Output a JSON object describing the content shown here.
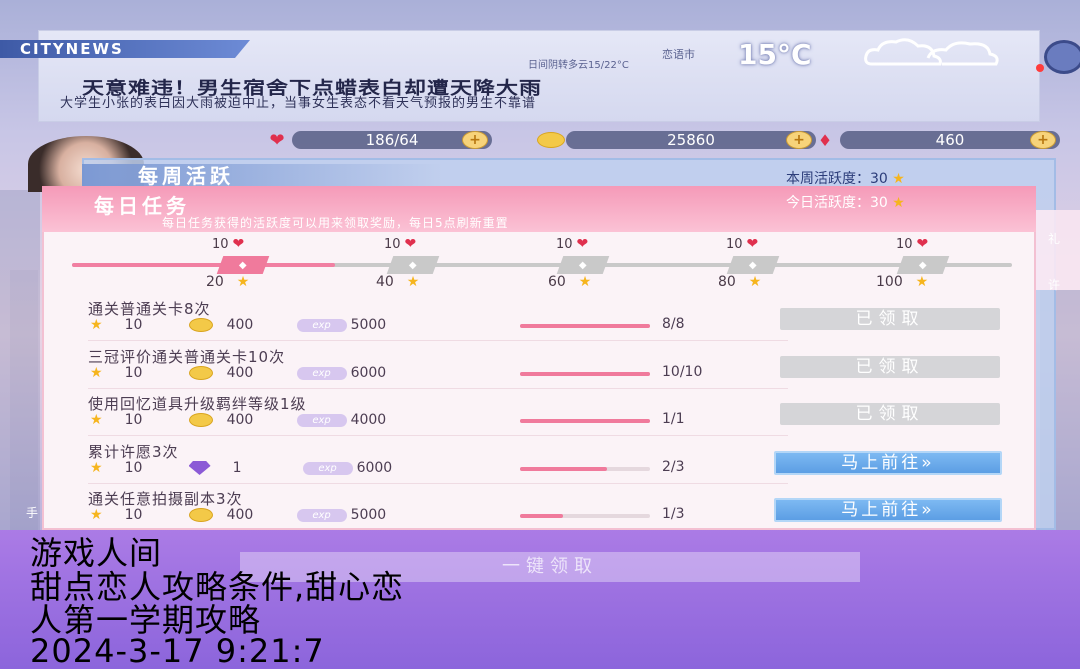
{
  "news": {
    "brand": "CITYNEWS",
    "city": "恋语市",
    "weather_desc": "日间阴转多云15/22°C",
    "temperature": "15°C",
    "weather_icon": "cloud-icon",
    "headline": "天意难违！男生宿舍下点蜡表白却遭天降大雨",
    "subline": "大学生小张的表白因大雨被迫中止，当事女生表态不看天气预报的男生不靠谱"
  },
  "resources": [
    {
      "icon": "heart-icon",
      "value": "186/64"
    },
    {
      "icon": "coin-icon",
      "value": "25860"
    },
    {
      "icon": "diamond-icon",
      "value": "460"
    }
  ],
  "weekly": {
    "title": "每周活跃",
    "activity": "本周活跃度：30"
  },
  "daily": {
    "title": "每日任务",
    "activity": "今日活跃度：30",
    "description": "每日任务获得的活跃度可以用来领取奖励，每日5点刷新重置",
    "progress_fraction": 0.28,
    "milestones": [
      {
        "reward": "10",
        "threshold": "20",
        "reached": true
      },
      {
        "reward": "10",
        "threshold": "40",
        "reached": false
      },
      {
        "reward": "10",
        "threshold": "60",
        "reached": false
      },
      {
        "reward": "10",
        "threshold": "80",
        "reached": false
      },
      {
        "reward": "10",
        "threshold": "100",
        "reached": false
      }
    ],
    "tasks": [
      {
        "name": "通关普通关卡8次",
        "stars": "10",
        "second_icon": "coin",
        "second": "400",
        "exp": "5000",
        "progress": "8/8",
        "fraction": 1.0,
        "status": "已领取"
      },
      {
        "name": "三冠评价通关普通关卡10次",
        "stars": "10",
        "second_icon": "coin",
        "second": "400",
        "exp": "6000",
        "progress": "10/10",
        "fraction": 1.0,
        "status": "已领取"
      },
      {
        "name": "使用回忆道具升级羁绊等级1级",
        "stars": "10",
        "second_icon": "coin",
        "second": "400",
        "exp": "4000",
        "progress": "1/1",
        "fraction": 1.0,
        "status": "已领取"
      },
      {
        "name": "累计许愿3次",
        "stars": "10",
        "second_icon": "diamond",
        "second": "1",
        "exp": "6000",
        "progress": "2/3",
        "fraction": 0.667,
        "status": "马上前往»"
      },
      {
        "name": "通关任意拍摄副本3次",
        "stars": "10",
        "second_icon": "coin",
        "second": "400",
        "exp": "5000",
        "progress": "1/3",
        "fraction": 0.333,
        "status": "马上前往»"
      }
    ],
    "claim_all": "一键领取"
  },
  "exp_label": "exp",
  "side_tabs": [
    "礼",
    "许"
  ],
  "side_hand": "手",
  "caption": {
    "line1": "游戏人间",
    "line2": "甜点恋人攻略条件,甜心恋",
    "line3": "人第一学期攻略",
    "line4": "2024-3-17 9:21:7"
  },
  "colors": {
    "accent_pink": "#f07a9c",
    "go_blue": "#5c9ee4",
    "caption_bg": "#9a70e0"
  }
}
